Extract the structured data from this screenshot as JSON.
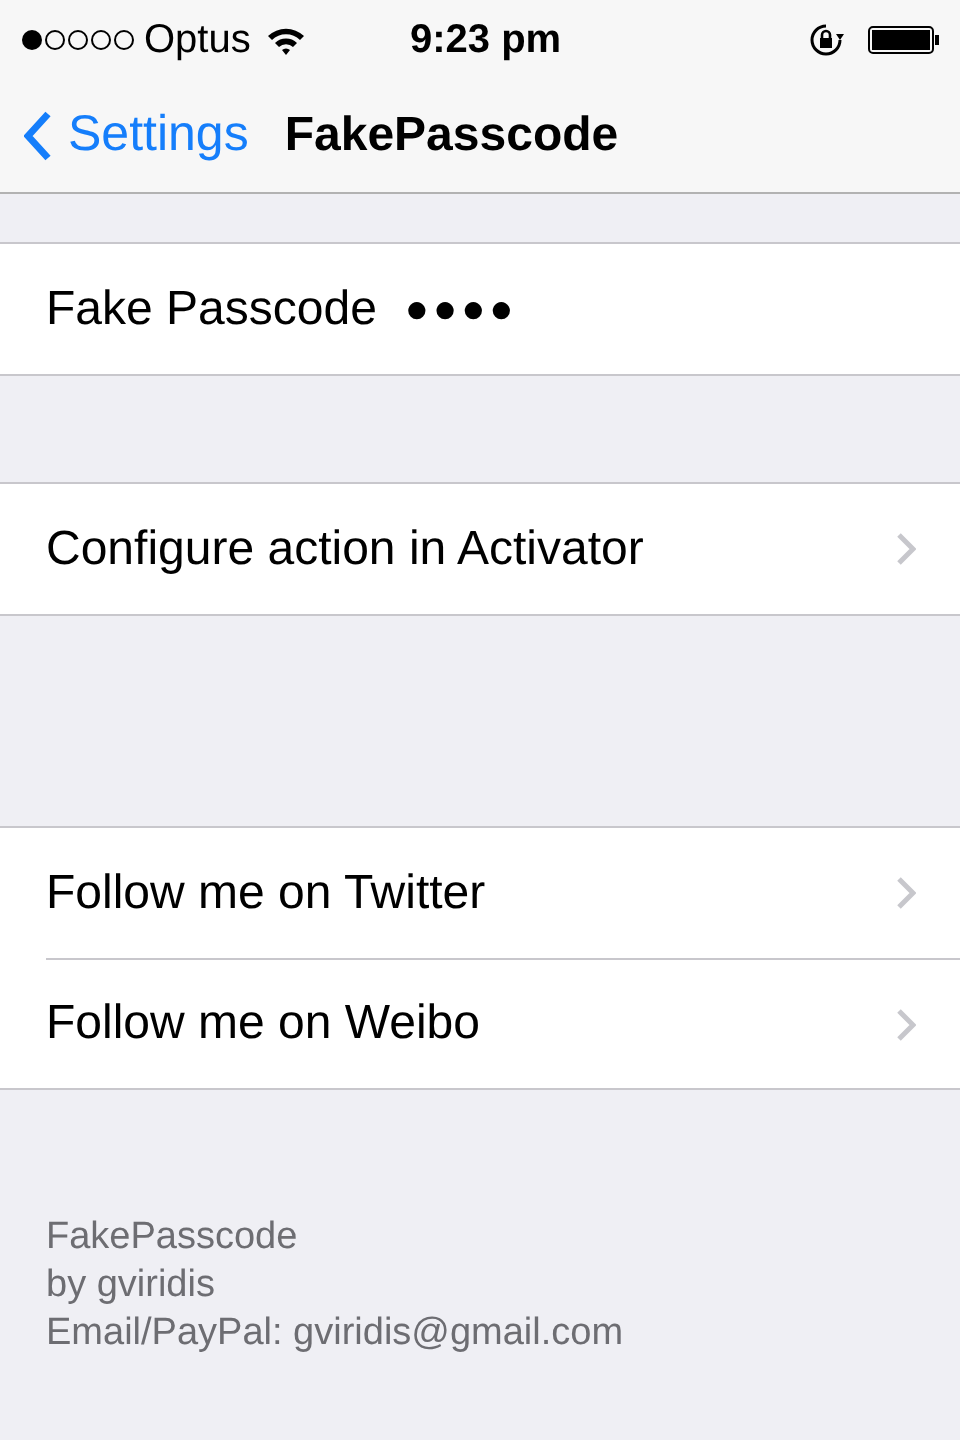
{
  "status_bar": {
    "carrier": "Optus",
    "time": "9:23 pm"
  },
  "nav_bar": {
    "back": "Settings",
    "title": "FakePasscode"
  },
  "groups": [
    {
      "rows": [
        {
          "kind": "field",
          "label": "Fake Passcode",
          "value": "●●●●"
        }
      ]
    },
    {
      "rows": [
        {
          "kind": "link",
          "label": "Configure action in Activator"
        }
      ]
    },
    {
      "rows": [
        {
          "kind": "link",
          "label": "Follow me on Twitter"
        },
        {
          "kind": "link",
          "label": "Follow me on Weibo"
        }
      ]
    }
  ],
  "footer": [
    "FakePasscode",
    "by gviridis",
    "Email/PayPal: gviridis@gmail.com"
  ]
}
